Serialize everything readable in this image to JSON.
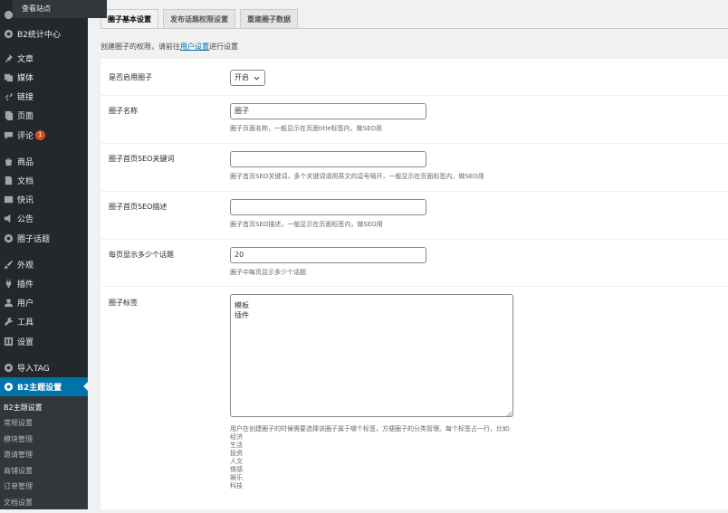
{
  "flyout": {
    "label": "查看站点"
  },
  "sidebar": {
    "items": [
      {
        "label": "B2统计中心",
        "icon": "gear-icon"
      },
      {
        "label": "文章",
        "icon": "pin-icon"
      },
      {
        "label": "媒体",
        "icon": "media-icon"
      },
      {
        "label": "链接",
        "icon": "link-icon"
      },
      {
        "label": "页面",
        "icon": "page-icon"
      },
      {
        "label": "评论",
        "icon": "comment-icon",
        "badge": "1"
      },
      {
        "label": "商品",
        "icon": "product-icon"
      },
      {
        "label": "文档",
        "icon": "document-icon"
      },
      {
        "label": "快讯",
        "icon": "news-icon"
      },
      {
        "label": "公告",
        "icon": "megaphone-icon"
      },
      {
        "label": "圈子话题",
        "icon": "gear-icon"
      },
      {
        "label": "外观",
        "icon": "brush-icon"
      },
      {
        "label": "插件",
        "icon": "plugin-icon"
      },
      {
        "label": "用户",
        "icon": "user-icon"
      },
      {
        "label": "工具",
        "icon": "wrench-icon"
      },
      {
        "label": "设置",
        "icon": "settings-icon"
      },
      {
        "label": "导入TAG",
        "icon": "gear-icon"
      },
      {
        "label": "B2主题设置",
        "icon": "gear-icon"
      }
    ],
    "submenu": [
      "B2主题设置",
      "常规设置",
      "模块管理",
      "邀请管理",
      "商铺设置",
      "订单管理",
      "文档设置"
    ]
  },
  "tabs": [
    "圈子基本设置",
    "发布话题权限设置",
    "重建圈子数据"
  ],
  "notice": {
    "prefix": "创建圈子的权限，请前往",
    "link": "用户设置",
    "suffix": "进行设置"
  },
  "fields": {
    "enable": {
      "label": "是否启用圈子",
      "value": "开启"
    },
    "name": {
      "label": "圈子名称",
      "value": "圈子",
      "desc": "圈子页面名称，一般显示在页面title标签内，做SEO用"
    },
    "seo_keywords": {
      "label": "圈子首页SEO关键词",
      "value": "",
      "desc": "圈子首页SEO关键词，多个关键词请用英文的逗号隔开，一般显示在页面标签内，做SEO用"
    },
    "seo_desc": {
      "label": "圈子首页SEO描述",
      "value": "",
      "desc": "圈子首页SEO描述，一般显示在页面标签内，做SEO用"
    },
    "per_page": {
      "label": "每页显示多少个话题",
      "value": "20",
      "desc": "圈子中每页显示多少个话题"
    },
    "tags": {
      "label": "圈子标签",
      "lines": [
        "模板",
        "插件"
      ],
      "desc": "用户在创建圈子的时候需要选择该圈子属于哪个标签，方便圈子的分类管理。每个标签占一行，比如:",
      "examples": [
        "经济",
        "生活",
        "投资",
        "人文",
        "情感",
        "娱乐",
        "科技"
      ]
    }
  }
}
